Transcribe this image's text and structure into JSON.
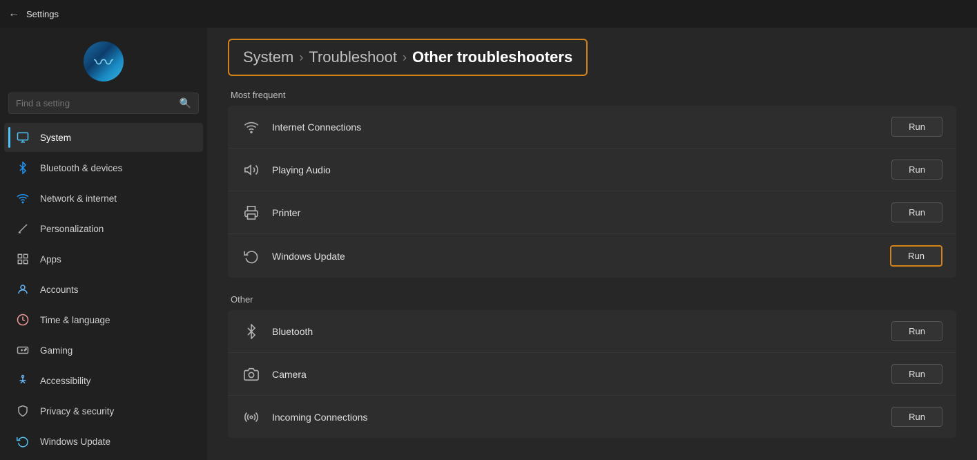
{
  "titleBar": {
    "back": "←",
    "title": "Settings"
  },
  "sidebar": {
    "searchPlaceholder": "Find a setting",
    "navItems": [
      {
        "id": "system",
        "label": "System",
        "icon": "🖥",
        "active": true,
        "iconColor": "#4fc3f7"
      },
      {
        "id": "bluetooth",
        "label": "Bluetooth & devices",
        "icon": "⬡",
        "active": false,
        "iconColor": "#2196f3"
      },
      {
        "id": "network",
        "label": "Network & internet",
        "icon": "🌐",
        "active": false,
        "iconColor": "#2196f3"
      },
      {
        "id": "personalization",
        "label": "Personalization",
        "icon": "✏",
        "active": false,
        "iconColor": "#9e9e9e"
      },
      {
        "id": "apps",
        "label": "Apps",
        "icon": "⊞",
        "active": false,
        "iconColor": "#9e9e9e"
      },
      {
        "id": "accounts",
        "label": "Accounts",
        "icon": "👤",
        "active": false,
        "iconColor": "#64b5f6"
      },
      {
        "id": "time",
        "label": "Time & language",
        "icon": "🕐",
        "active": false,
        "iconColor": "#ef9a9a"
      },
      {
        "id": "gaming",
        "label": "Gaming",
        "icon": "🎮",
        "active": false,
        "iconColor": "#9e9e9e"
      },
      {
        "id": "accessibility",
        "label": "Accessibility",
        "icon": "♿",
        "active": false,
        "iconColor": "#64b5f6"
      },
      {
        "id": "privacy",
        "label": "Privacy & security",
        "icon": "🛡",
        "active": false,
        "iconColor": "#9e9e9e"
      },
      {
        "id": "windows-update",
        "label": "Windows Update",
        "icon": "🔄",
        "active": false,
        "iconColor": "#4fc3f7"
      }
    ]
  },
  "breadcrumb": {
    "segments": [
      "System",
      "Troubleshoot",
      "Other troubleshooters"
    ]
  },
  "mostFrequent": {
    "sectionTitle": "Most frequent",
    "items": [
      {
        "id": "internet",
        "name": "Internet Connections",
        "icon": "wifi",
        "runLabel": "Run"
      },
      {
        "id": "audio",
        "name": "Playing Audio",
        "icon": "audio",
        "runLabel": "Run"
      },
      {
        "id": "printer",
        "name": "Printer",
        "icon": "printer",
        "runLabel": "Run"
      },
      {
        "id": "windows-update",
        "name": "Windows Update",
        "icon": "refresh",
        "runLabel": "Run",
        "highlighted": true
      }
    ]
  },
  "other": {
    "sectionTitle": "Other",
    "items": [
      {
        "id": "bluetooth",
        "name": "Bluetooth",
        "icon": "bluetooth",
        "runLabel": "Run"
      },
      {
        "id": "camera",
        "name": "Camera",
        "icon": "camera",
        "runLabel": "Run"
      },
      {
        "id": "incoming",
        "name": "Incoming Connections",
        "icon": "signal",
        "runLabel": "Run"
      }
    ]
  }
}
